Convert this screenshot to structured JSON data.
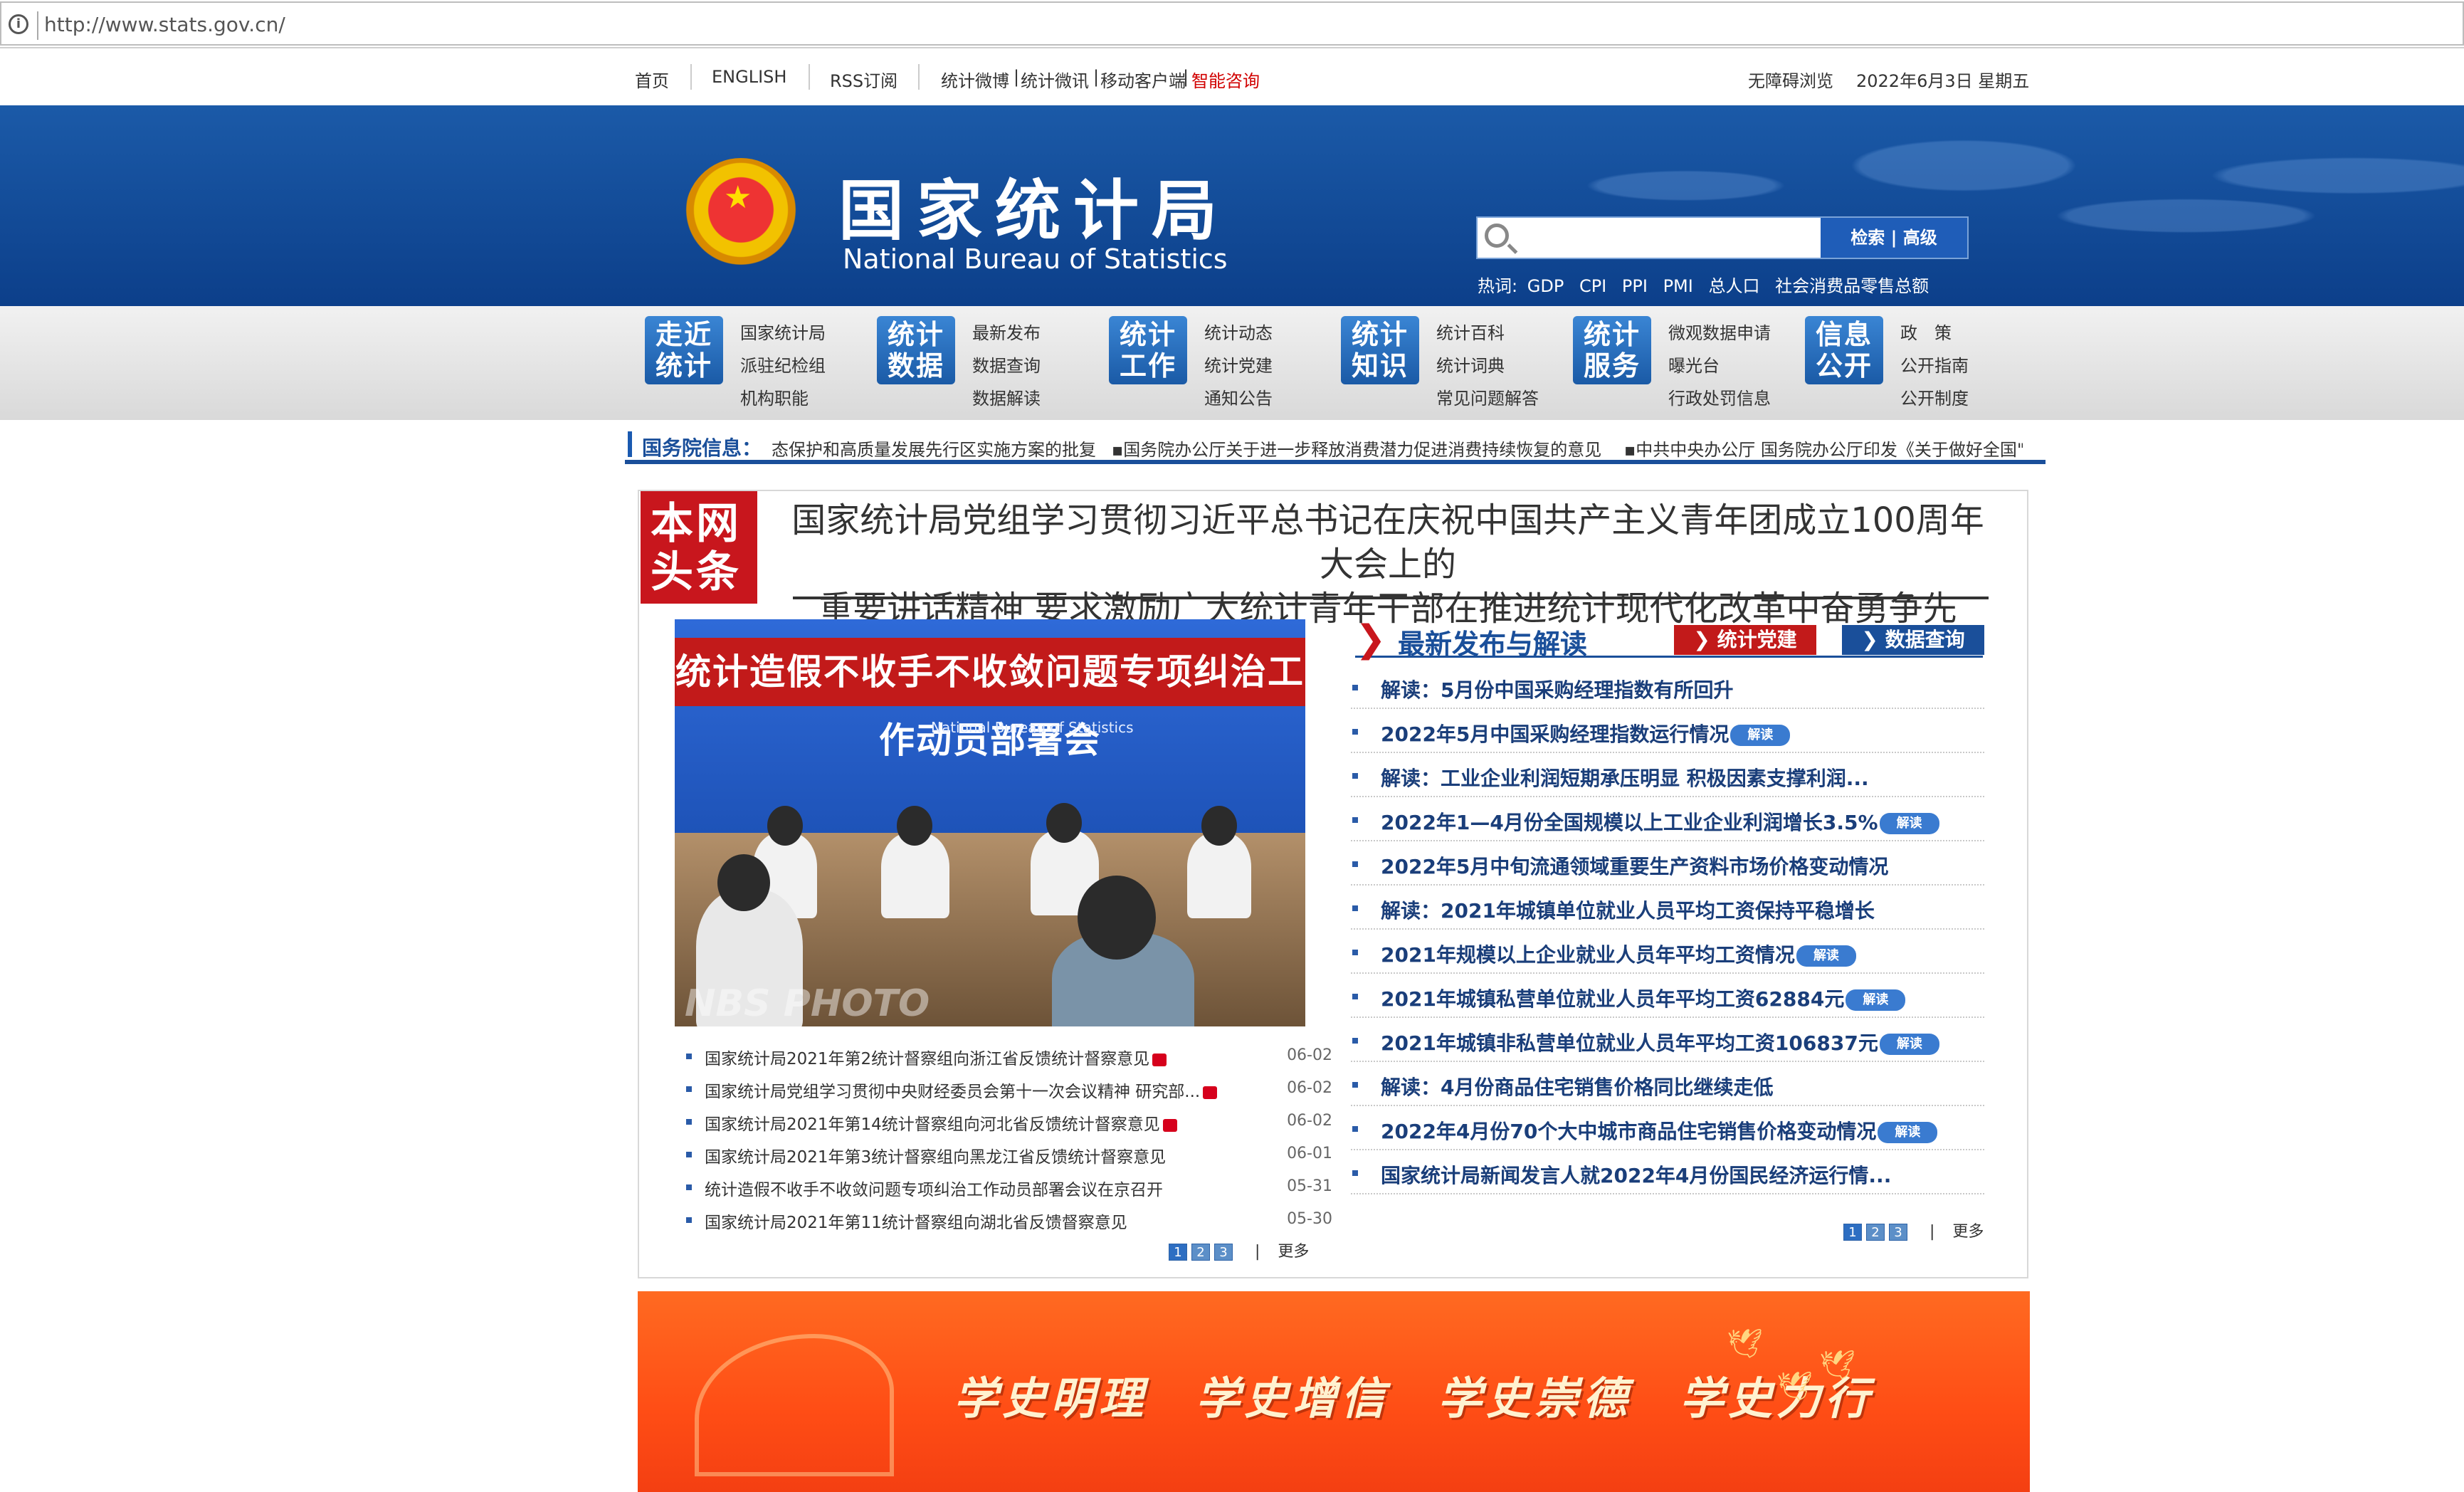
{
  "browser": {
    "url": "http://www.stats.gov.cn/"
  },
  "topnav": {
    "items": [
      "首页",
      "ENGLISH",
      "RSS订阅",
      "统计微博",
      "统计微讯",
      "移动客户端",
      "智能咨询"
    ],
    "accessibility": "无障碍浏览",
    "date": "2022年6月3日 星期五"
  },
  "header": {
    "title_cn": "国家统计局",
    "title_en": "National Bureau of Statistics",
    "search_placeholder": "",
    "search_button": "检索 | 高级",
    "hot_label": "热词:",
    "hot_words": [
      "GDP",
      "CPI",
      "PPI",
      "PMI",
      "总人口",
      "社会消费品零售总额"
    ]
  },
  "categories": [
    {
      "icon": "走近\n统计",
      "links": [
        "国家统计局",
        "派驻纪检组",
        "机构职能"
      ]
    },
    {
      "icon": "统计\n数据",
      "links": [
        "最新发布",
        "数据查询",
        "数据解读"
      ]
    },
    {
      "icon": "统计\n工作",
      "links": [
        "统计动态",
        "统计党建",
        "通知公告"
      ]
    },
    {
      "icon": "统计\n知识",
      "links": [
        "统计百科",
        "统计词典",
        "常见问题解答"
      ]
    },
    {
      "icon": "统计\n服务",
      "links": [
        "微观数据申请",
        "曝光台",
        "行政处罚信息"
      ]
    },
    {
      "icon": "信息\n公开",
      "links": [
        "政　策",
        "公开指南",
        "公开制度"
      ]
    }
  ],
  "notice": {
    "label": "国务院信息：",
    "items": [
      "态保护和高质量发展先行区实施方案的批复",
      "▪国务院办公厅关于进一步释放消费潜力促进消费持续恢复的意见",
      "▪中共中央办公厅 国务院办公厅印发《关于做好全国\"."
    ]
  },
  "headline": {
    "tag": "本网\n头条",
    "line1": "国家统计局党组学习贯彻习近平总书记在庆祝中国共产主义青年团成立100周年大会上的",
    "line2": "重要讲话精神 要求激励广大统计青年干部在推进统计现代化改革中奋勇争先"
  },
  "photo": {
    "banner": "统计造假不收手不收敛问题专项纠治工作动员部署会",
    "subtitle": "National Bureau of Statistics",
    "watermark": "NBS PHOTO"
  },
  "left_list": [
    {
      "title": "国家统计局2021年第2统计督察组向浙江省反馈统计督察意见",
      "new": true,
      "date": "06-02"
    },
    {
      "title": "国家统计局党组学习贯彻中央财经委员会第十一次会议精神 研究部...",
      "new": true,
      "date": "06-02"
    },
    {
      "title": "国家统计局2021年第14统计督察组向河北省反馈统计督察意见",
      "new": true,
      "date": "06-02"
    },
    {
      "title": "国家统计局2021年第3统计督察组向黑龙江省反馈统计督察意见",
      "new": false,
      "date": "06-01"
    },
    {
      "title": "统计造假不收手不收敛问题专项纠治工作动员部署会议在京召开",
      "new": false,
      "date": "05-31"
    },
    {
      "title": "国家统计局2021年第11统计督察组向湖北省反馈督察意见",
      "new": false,
      "date": "05-30"
    }
  ],
  "left_pager": {
    "pages": [
      "1",
      "2",
      "3"
    ],
    "sep": "|",
    "more": "更多"
  },
  "right_section": {
    "title": "最新发布与解读",
    "btn1": "统计党建",
    "btn2": "数据查询",
    "badge": "解读",
    "items": [
      {
        "title": "解读：5月份中国采购经理指数有所回升",
        "badge": false
      },
      {
        "title": "2022年5月中国采购经理指数运行情况",
        "badge": true
      },
      {
        "title": "解读：工业企业利润短期承压明显 积极因素支撑利润...",
        "badge": false
      },
      {
        "title": "2022年1—4月份全国规模以上工业企业利润增长3.5%",
        "badge": true
      },
      {
        "title": "2022年5月中旬流通领域重要生产资料市场价格变动情况",
        "badge": false
      },
      {
        "title": "解读：2021年城镇单位就业人员平均工资保持平稳增长",
        "badge": false
      },
      {
        "title": "2021年规模以上企业就业人员年平均工资情况",
        "badge": true
      },
      {
        "title": "2021年城镇私营单位就业人员年平均工资62884元",
        "badge": true
      },
      {
        "title": "2021年城镇非私营单位就业人员年平均工资106837元",
        "badge": true
      },
      {
        "title": "解读：4月份商品住宅销售价格同比继续走低",
        "badge": false
      },
      {
        "title": "2022年4月份70个大中城市商品住宅销售价格变动情况",
        "badge": true
      },
      {
        "title": "国家统计局新闻发言人就2022年4月份国民经济运行情...",
        "badge": false
      }
    ]
  },
  "right_pager": {
    "pages": [
      "1",
      "2",
      "3"
    ],
    "sep": "|",
    "more": "更多"
  },
  "promo": {
    "slogan": "学史明理　学史增信　学史崇德　学史力行"
  },
  "colors": {
    "brand_blue": "#1a4f9a",
    "accent_red": "#c8161d",
    "promo_orange": "#ff5a1a"
  }
}
